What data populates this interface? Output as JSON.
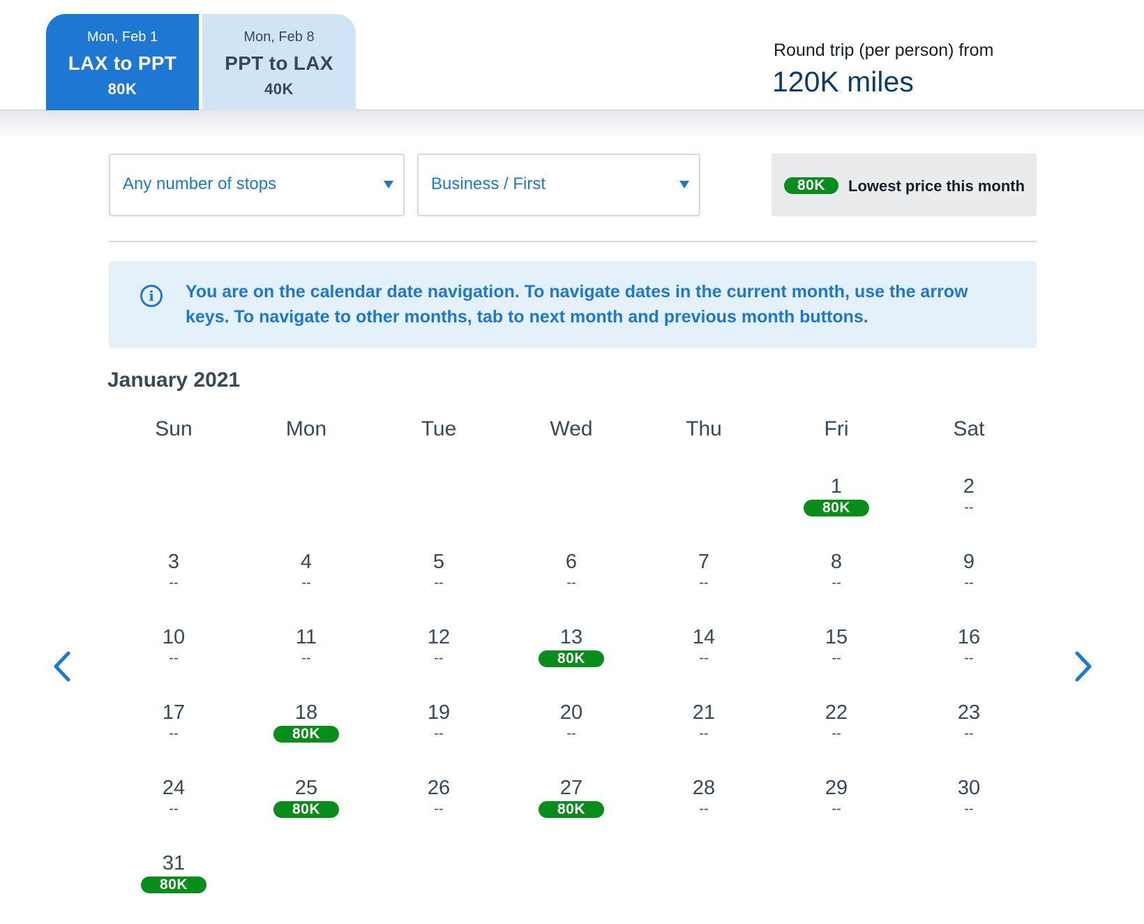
{
  "segments": [
    {
      "date": "Mon, Feb 1",
      "route": "LAX to PPT",
      "price": "80K",
      "active": true
    },
    {
      "date": "Mon, Feb 8",
      "route": "PPT to LAX",
      "price": "40K",
      "active": false
    }
  ],
  "round_trip": {
    "label": "Round trip (per person) from",
    "miles": "120K miles"
  },
  "filters": {
    "stops": "Any number of stops",
    "cabin": "Business / First"
  },
  "legend": {
    "badge": "80K",
    "text": "Lowest price this month"
  },
  "info": {
    "icon": "info-icon",
    "message": "You are on the calendar date navigation. To navigate dates in the current month, use the arrow keys. To navigate to other months, tab to next month and previous month buttons."
  },
  "calendar": {
    "month": "January 2021",
    "weekdays": [
      "Sun",
      "Mon",
      "Tue",
      "Wed",
      "Thu",
      "Fri",
      "Sat"
    ],
    "first_weekday_index": 5,
    "days": [
      {
        "day": "1",
        "price": "80K"
      },
      {
        "day": "2",
        "price": "--"
      },
      {
        "day": "3",
        "price": "--"
      },
      {
        "day": "4",
        "price": "--"
      },
      {
        "day": "5",
        "price": "--"
      },
      {
        "day": "6",
        "price": "--"
      },
      {
        "day": "7",
        "price": "--"
      },
      {
        "day": "8",
        "price": "--"
      },
      {
        "day": "9",
        "price": "--"
      },
      {
        "day": "10",
        "price": "--"
      },
      {
        "day": "11",
        "price": "--"
      },
      {
        "day": "12",
        "price": "--"
      },
      {
        "day": "13",
        "price": "80K"
      },
      {
        "day": "14",
        "price": "--"
      },
      {
        "day": "15",
        "price": "--"
      },
      {
        "day": "16",
        "price": "--"
      },
      {
        "day": "17",
        "price": "--"
      },
      {
        "day": "18",
        "price": "80K"
      },
      {
        "day": "19",
        "price": "--"
      },
      {
        "day": "20",
        "price": "--"
      },
      {
        "day": "21",
        "price": "--"
      },
      {
        "day": "22",
        "price": "--"
      },
      {
        "day": "23",
        "price": "--"
      },
      {
        "day": "24",
        "price": "--"
      },
      {
        "day": "25",
        "price": "80K"
      },
      {
        "day": "26",
        "price": "--"
      },
      {
        "day": "27",
        "price": "80K"
      },
      {
        "day": "28",
        "price": "--"
      },
      {
        "day": "29",
        "price": "--"
      },
      {
        "day": "30",
        "price": "--"
      },
      {
        "day": "31",
        "price": "80K"
      }
    ],
    "prev_icon": "chevron-left-icon",
    "next_icon": "chevron-right-icon"
  },
  "colors": {
    "accent": "#1e77d2",
    "lowest_price": "#088c1a",
    "text": "#36495a",
    "info_bg": "#e4f0fa"
  }
}
